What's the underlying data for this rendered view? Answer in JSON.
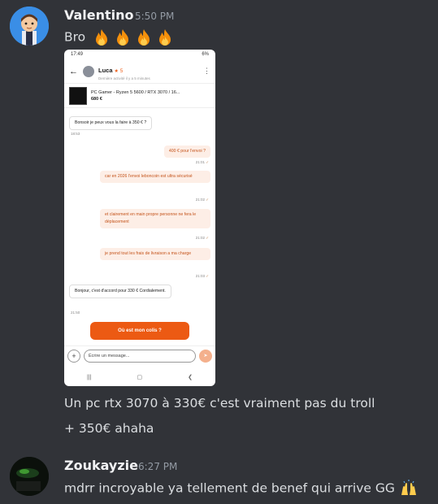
{
  "messages": [
    {
      "author": "Valentino",
      "time": "5:50 PM",
      "text": "Bro",
      "emojis": [
        "fire-emoji",
        "fire-emoji",
        "fire-emoji",
        "fire-emoji"
      ],
      "followup_line1": "Un pc rtx 3070 à 330€ c'est vraiment pas du troll",
      "followup_line2": "+ 350€ ahaha"
    },
    {
      "author": "Zoukayzie",
      "time": "6:27 PM",
      "text": "mdrr incroyable ya tellement de benef qui arrive GG",
      "emoji": "raised-hands-emoji"
    }
  ],
  "screenshot": {
    "status_time": "17:49",
    "status_right": "6%",
    "contact_name": "Luca",
    "contact_rating": "5",
    "contact_sub": "Dernière activité il y a 5 minutes",
    "product_title": "PC Gamer - Ryzen 5 5600 / RTX 3070 / 16...",
    "product_price": "680 €",
    "chat": [
      {
        "dir": "in",
        "text": "Bonsoir je peux vous la faire à 350 € ?",
        "time": "18:53"
      },
      {
        "dir": "out",
        "text": "400 € pour l'envoi ?",
        "time": "21:01"
      },
      {
        "dir": "out",
        "text": "car en 2026 l'envoi leboncoin est ultra sécurisé",
        "time": "21:02"
      },
      {
        "dir": "out",
        "text": "et clairement en main propre personne ne fera le déplacement",
        "time": "21:02"
      },
      {
        "dir": "out",
        "text": "je prend tout les frais de livraison a ma charge",
        "time": "21:03"
      },
      {
        "dir": "in",
        "text": "Bonjour, c'est d'accord pour 330 € Cordialement.",
        "time": "21:50"
      }
    ],
    "cta_label": "Où est mon colis ?",
    "input_placeholder": "Écrire un message..."
  }
}
